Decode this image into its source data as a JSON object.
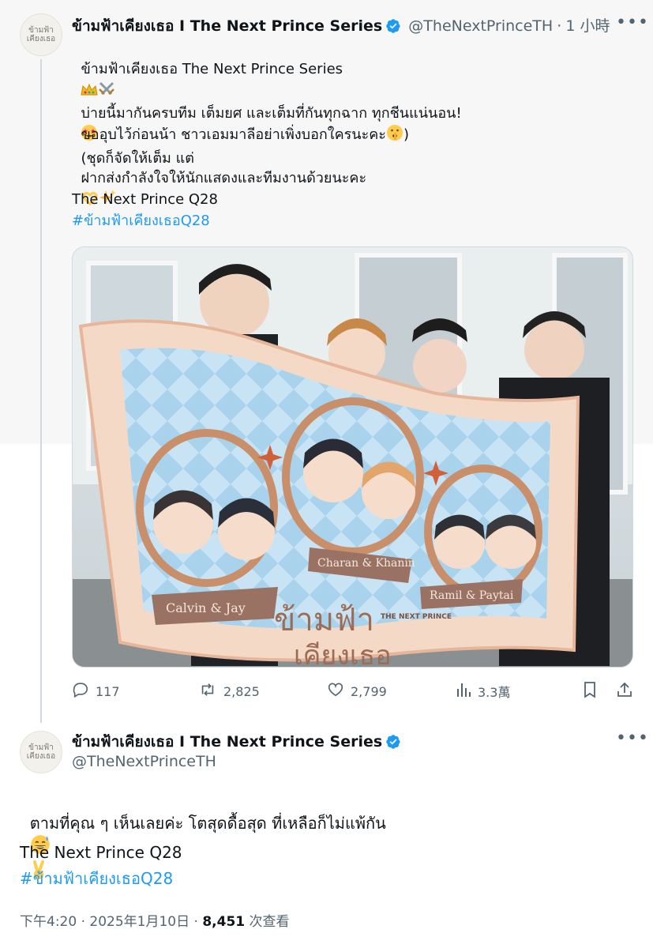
{
  "tweet1": {
    "avatar_logo_text": "ข้ามฟ้า เคียงเธอ",
    "display_name": "ข้ามฟ้าเคียงเธอ I The Next Prince Series",
    "handle": "@TheNextPrinceTH",
    "separator": "·",
    "time": "1 小時",
    "line1": "ข้ามฟ้าเคียงเธอ The Next Prince Series",
    "para2_line1": "บ่ายนี้มากันครบทีม เต็มยศ และเต็มที่กันทุกฉาก ทุกชีนแน่นอน!",
    "para2_line1_tail": "(ชุดก็จัดให้เต็ม แต่",
    "para2_line2": "ขออุบไว้ก่อนน้า ชาวเอมมาลีอย่าเพิ่งบอกใครนะคะ",
    "para2_line2_tail": ")",
    "para3": "ฝากส่งกำลังใจให้นักแสดงและทีมงานด้วยนะคะ",
    "para4": "The Next Prince Q28",
    "hashtag": "#ข้ามฟ้าเคียงเธอQ28",
    "media": {
      "banner_pairs": [
        "Calvin & Jay",
        "Charan & Khanin",
        "Ramil & Paytai"
      ],
      "banner_title": "ข้ามฟ้า",
      "banner_subtitle": "เคียงเธอ",
      "banner_small": "THE NEXT PRINCE"
    },
    "stats": {
      "replies": "117",
      "reposts": "2,825",
      "likes": "2,799",
      "views": "3.3萬"
    }
  },
  "tweet2": {
    "avatar_logo_text": "ข้ามฟ้า เคียงเธอ",
    "display_name": "ข้ามฟ้าเคียงเธอ I The Next Prince Series",
    "handle": "@TheNextPrinceTH",
    "line1": "ตามที่คุณ ๆ เห็นเลยค่ะ โตสุดดื้อสุด ที่เหลือก็ไม่แพ้กัน",
    "line2": "The Next Prince Q28",
    "hashtag": "#ข้ามฟ้าเคียงเธอQ28",
    "meta_time": "下午4:20",
    "meta_dot": "·",
    "meta_date": "2025年1月10日",
    "meta_views_count": "8,451",
    "meta_views_label": "次查看"
  },
  "colors": {
    "accent": "#1d9bf0",
    "muted": "#536471",
    "text": "#0f1419",
    "thread_line": "#cfd9de"
  },
  "icons": [
    "verified-badge-icon",
    "more-icon",
    "reply-icon",
    "repost-icon",
    "like-icon",
    "views-icon",
    "bookmark-icon",
    "share-icon"
  ]
}
